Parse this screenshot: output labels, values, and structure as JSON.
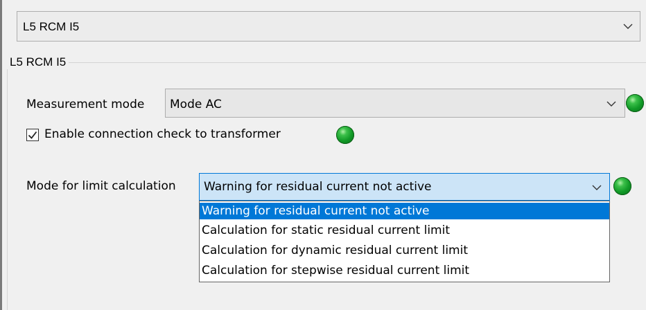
{
  "channel_select": {
    "value": "L5 RCM I5"
  },
  "group": {
    "title": "L5 RCM I5"
  },
  "measurement_mode": {
    "label": "Measurement mode",
    "value": "Mode AC"
  },
  "connection_check": {
    "label": "Enable connection check to transformer",
    "checked": true
  },
  "limit_mode": {
    "label": "Mode for limit calculation",
    "value": "Warning for residual current not active",
    "options": [
      "Warning for residual current not active",
      "Calculation for static residual current limit",
      "Calculation for dynamic residual current limit",
      "Calculation for stepwise residual current limit"
    ]
  },
  "colors": {
    "accent": "#0078d7",
    "combo_open_bg": "#cce4f7",
    "status_led": "#1aa32f"
  },
  "icons": [
    "chevron-down-icon",
    "checkmark-icon",
    "status-led-icon"
  ]
}
